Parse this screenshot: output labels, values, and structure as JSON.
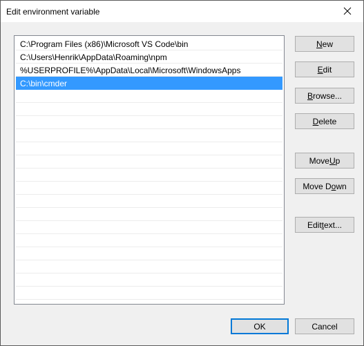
{
  "window": {
    "title": "Edit environment variable"
  },
  "list": {
    "items": [
      {
        "label": "C:\\Program Files (x86)\\Microsoft VS Code\\bin",
        "selected": false
      },
      {
        "label": "C:\\Users\\Henrik\\AppData\\Roaming\\npm",
        "selected": false
      },
      {
        "label": "%USERPROFILE%\\AppData\\Local\\Microsoft\\WindowsApps",
        "selected": false
      },
      {
        "label": "C:\\bin\\cmder",
        "selected": true
      }
    ],
    "empty_rows": 16,
    "selection_color": "#3399ff"
  },
  "buttons": {
    "new": {
      "pre": "",
      "key": "N",
      "post": "ew"
    },
    "edit": {
      "pre": "",
      "key": "E",
      "post": "dit"
    },
    "browse": {
      "pre": "",
      "key": "B",
      "post": "rowse..."
    },
    "delete": {
      "pre": "",
      "key": "D",
      "post": "elete"
    },
    "move_up": {
      "pre": "Move ",
      "key": "U",
      "post": "p"
    },
    "move_down": {
      "pre": "Move D",
      "key": "o",
      "post": "wn"
    },
    "edit_text": {
      "pre": "Edit ",
      "key": "t",
      "post": "ext..."
    },
    "ok": {
      "pre": "OK",
      "key": "",
      "post": ""
    },
    "cancel": {
      "pre": "Cancel",
      "key": "",
      "post": ""
    }
  },
  "icons": {
    "close": "close-icon"
  },
  "colors": {
    "accent": "#0078d7",
    "button_face": "#e1e1e1",
    "button_border": "#adadad"
  }
}
